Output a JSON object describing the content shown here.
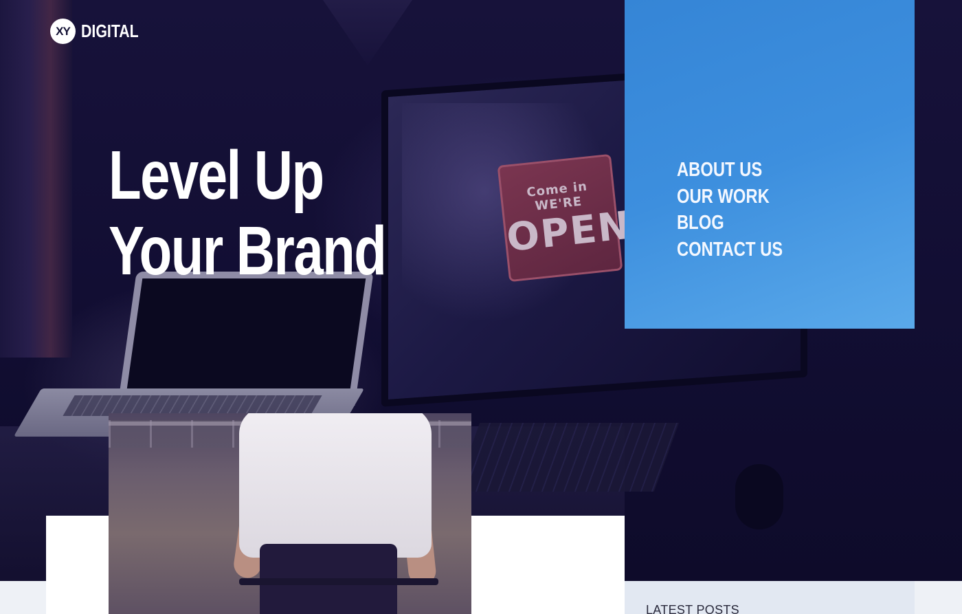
{
  "header": {
    "logo_badge": "XY",
    "logo_text": "DIGITAL"
  },
  "hero": {
    "title_line1": "Level Up",
    "title_line2": "Your Brand",
    "sign_small": "Come in WE'RE",
    "sign_big": "OPEN"
  },
  "nav": {
    "items": [
      {
        "label": "ABOUT US"
      },
      {
        "label": "OUR WORK"
      },
      {
        "label": "BLOG"
      },
      {
        "label": "CONTACT US"
      }
    ]
  },
  "sidebar": {
    "latest_title": "LATEST POSTS"
  },
  "colors": {
    "nav_panel": "#3585d6",
    "hero_dark": "#120e33",
    "bottom_strip": "#eef1f6"
  }
}
